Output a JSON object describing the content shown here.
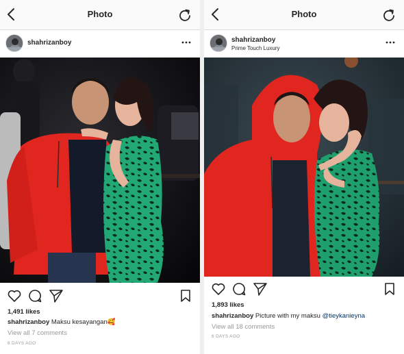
{
  "colors": {
    "nav_background": "#fafafa",
    "text": "#262626",
    "secondary_text": "#999999",
    "mention": "#003569",
    "divider": "#efefef",
    "hoodie_red": "#e0261f",
    "dress_green": "#1f9e6e"
  },
  "icons": {
    "back": "chevron-left-icon",
    "refresh": "refresh-icon",
    "more": "more-horizontal-icon",
    "like": "heart-icon",
    "comment": "comment-icon",
    "share": "send-icon",
    "save": "bookmark-icon"
  },
  "left_post": {
    "nav_title": "Photo",
    "username": "shahrizanboy",
    "likes": "1,491 likes",
    "caption_user": "shahrizanboy",
    "caption_text": "Maksu kesayangan",
    "caption_emoji": "🥰",
    "comments_link": "View all 7 comments",
    "timestamp": "6 DAYS AGO"
  },
  "right_post": {
    "nav_title": "Photo",
    "username": "shahrizanboy",
    "location": "Prime Touch Luxury",
    "likes": "1,893 likes",
    "caption_user": "shahrizanboy",
    "caption_text": "Picture with my maksu",
    "caption_mention": "@tieykanieyna",
    "comments_link": "View all 18 comments",
    "timestamp": "6 DAYS AGO"
  }
}
